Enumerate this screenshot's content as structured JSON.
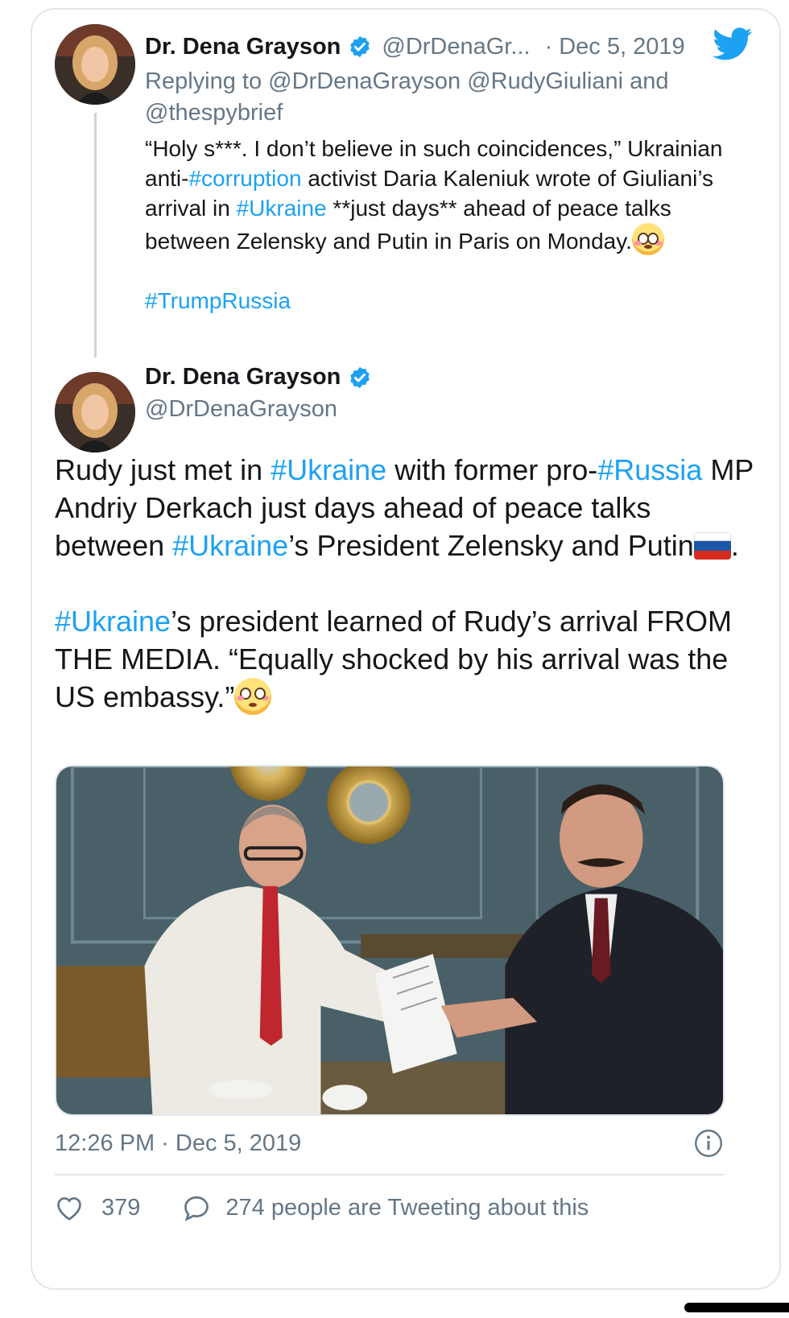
{
  "reply_tweet": {
    "author_name": "Dr. Dena Grayson",
    "author_handle": "@DrDenaGr...",
    "date_separator": "·",
    "date": "Dec 5, 2019",
    "replying_prefix": "Replying to",
    "replying_to_1": "@DrDenaGrayson",
    "replying_to_2": "@RudyGiuliani",
    "replying_and": "and",
    "replying_to_3": "@thespybrief",
    "text": {
      "p1_a": "“Holy s***. I don’t believe in such coincidences,” Ukrainian anti-",
      "p1_tag1": "#corruption",
      "p1_b": " activist Daria Kaleniuk wrote of Giuliani’s arrival in ",
      "p1_tag2": "#Ukraine",
      "p1_c": " **just days** ahead of peace talks between Zelensky and Putin in Paris on Monday.",
      "p2_tag": "#TrumpRussia"
    }
  },
  "main_tweet": {
    "author_name": "Dr. Dena Grayson",
    "author_handle": "@DrDenaGrayson",
    "text": {
      "a": "Rudy just met in ",
      "tag1": "#Ukraine",
      "b": " with former pro-",
      "tag2": "#Russia",
      "c": " MP Andriy Derkach just days ahead of peace talks between ",
      "tag3": "#Ukraine",
      "d": "’s President Zelensky and Putin",
      "e": ".",
      "tag4": "#Ukraine",
      "f": "’s president learned of Rudy’s arrival FROM THE MEDIA. “Equally shocked by his arrival was the US embassy.”"
    },
    "timestamp": "12:26 PM · Dec 5, 2019",
    "likes": "379",
    "discussion": "274 people are Tweeting about this"
  },
  "colors": {
    "link": "#1da1f2",
    "secondary_text": "#657786",
    "primary_text": "#14171a",
    "border": "#e1e8ed"
  },
  "icons": [
    "verified-badge-icon",
    "twitter-bird-icon",
    "info-icon",
    "heart-icon",
    "reply-bubble-icon",
    "flushed-face-emoji",
    "russia-flag-emoji"
  ]
}
